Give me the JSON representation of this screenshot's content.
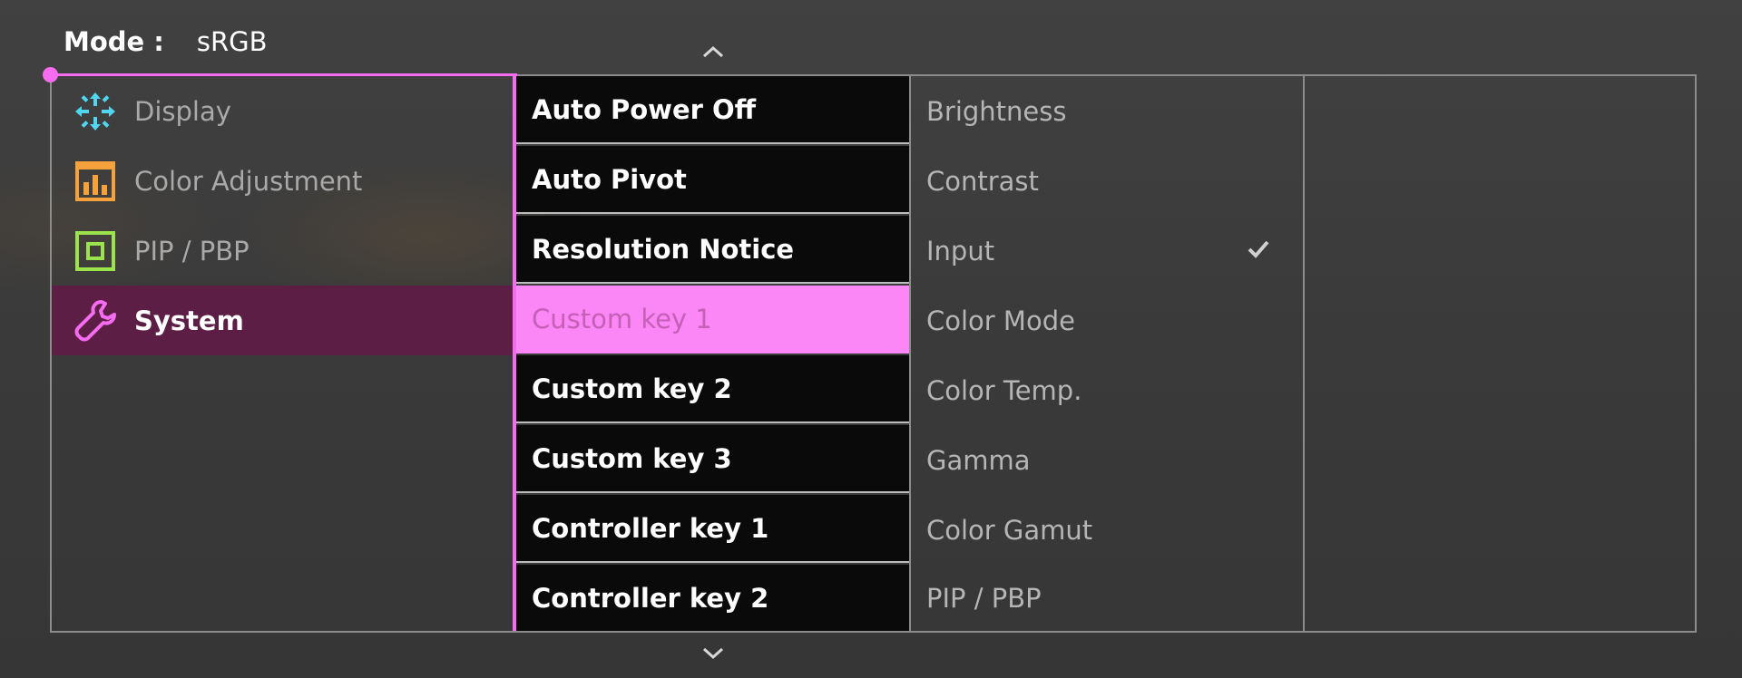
{
  "header": {
    "mode_label": "Mode :",
    "mode_value": "sRGB"
  },
  "colors": {
    "accent": "#f56cf0",
    "selected_category_bg": "#5c1e44",
    "selected_item_bg": "#fb86f5",
    "item_bg": "#0a0a0a"
  },
  "categories": [
    {
      "label": "Display",
      "icon": "display-icon",
      "icon_color": "#52d6f0",
      "selected": false
    },
    {
      "label": "Color Adjustment",
      "icon": "color-adjustment-icon",
      "icon_color": "#f5a23d",
      "selected": false
    },
    {
      "label": "PIP / PBP",
      "icon": "pip-pbp-icon",
      "icon_color": "#9be34a",
      "selected": false
    },
    {
      "label": "System",
      "icon": "wrench-icon",
      "icon_color": "#f56cf0",
      "selected": true
    }
  ],
  "system_items": [
    {
      "label": "Auto Power Off",
      "selected": false
    },
    {
      "label": "Auto Pivot",
      "selected": false
    },
    {
      "label": "Resolution Notice",
      "selected": false
    },
    {
      "label": "Custom key 1",
      "selected": true
    },
    {
      "label": "Custom key 2",
      "selected": false
    },
    {
      "label": "Custom key 3",
      "selected": false
    },
    {
      "label": "Controller key 1",
      "selected": false
    },
    {
      "label": "Controller key 2",
      "selected": false
    }
  ],
  "options": [
    {
      "label": "Brightness",
      "checked": false
    },
    {
      "label": "Contrast",
      "checked": false
    },
    {
      "label": "Input",
      "checked": true
    },
    {
      "label": "Color Mode",
      "checked": false
    },
    {
      "label": "Color Temp.",
      "checked": false
    },
    {
      "label": "Gamma",
      "checked": false
    },
    {
      "label": "Color Gamut",
      "checked": false
    },
    {
      "label": "PIP / PBP",
      "checked": false
    }
  ],
  "navigation": {
    "up_icon": "chevron-up-icon",
    "down_icon": "chevron-down-icon",
    "check_icon": "checkmark-icon"
  }
}
